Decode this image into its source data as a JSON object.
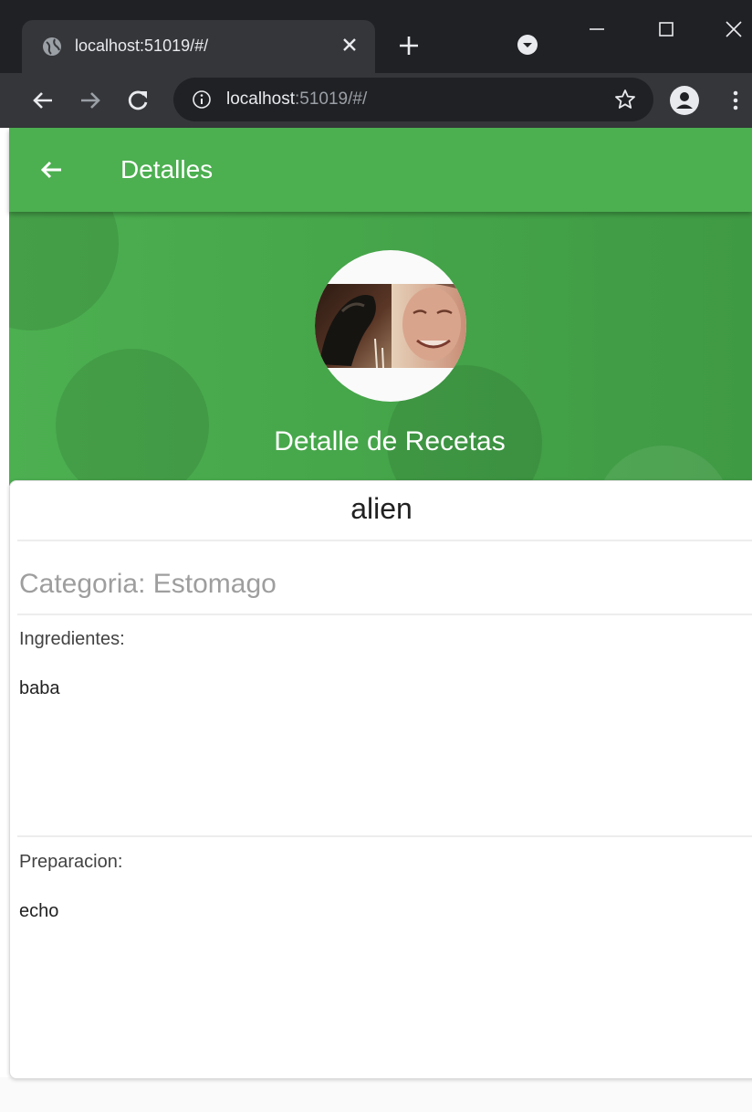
{
  "browser": {
    "tab": {
      "title": "localhost:51019/#/"
    },
    "address": {
      "host": "localhost",
      "rest": ":51019/#/"
    }
  },
  "app": {
    "appbar_title": "Detalles",
    "header_title": "Detalle de Recetas",
    "recipe": {
      "name": "alien",
      "category": "Categoria: Estomago",
      "ingredients_label": "Ingredientes:",
      "ingredients_value": "baba",
      "preparation_label": "Preparacion:",
      "preparation_value": "echo"
    }
  },
  "icons": {
    "favicon": "globe-icon",
    "tab_close": "close-icon",
    "new_tab": "plus-icon",
    "tab_search": "chevron-down-circle-icon",
    "minimize": "minimize-icon",
    "maximize": "maximize-icon",
    "window_close": "close-icon",
    "back": "arrow-left-icon",
    "forward": "arrow-right-icon",
    "reload": "reload-icon",
    "site_info": "info-icon",
    "bookmark": "star-icon",
    "profile": "person-icon",
    "menu": "kebab-icon",
    "appbar_back": "arrow-left-icon"
  },
  "colors": {
    "chrome_dark": "#202124",
    "chrome_toolbar": "#35363a",
    "primary_green": "#4caf50",
    "banner_green_dark": "#3f9a44",
    "category_gray": "#9e9e9e"
  }
}
